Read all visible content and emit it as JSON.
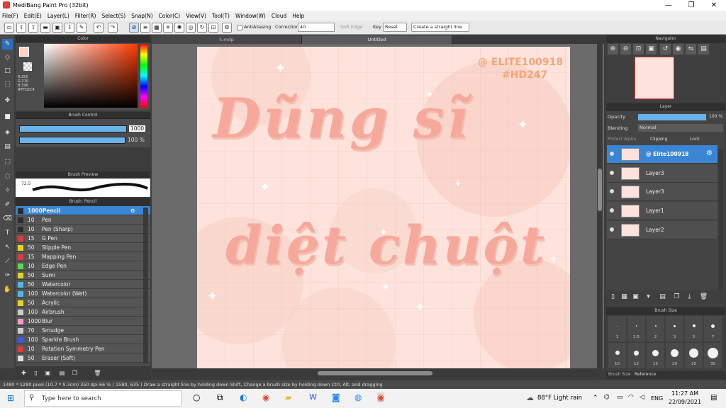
{
  "window": {
    "title": "MediBang Paint Pro (32bit)"
  },
  "menu": [
    "File(F)",
    "Edit(E)",
    "Layer(L)",
    "Filter(R)",
    "Select(S)",
    "Snap(N)",
    "Color(C)",
    "View(V)",
    "Tool(T)",
    "Window(W)",
    "Cloud",
    "Help"
  ],
  "toolbar": {
    "antialias": "AntiAliasing",
    "correction_label": "Correction",
    "correction_value": "40",
    "soft_edge": "Soft Edge",
    "key": "Key",
    "reset": "Reset",
    "straight_line": "Create a straight line"
  },
  "color_panel": {
    "title": "Color",
    "rgb": "R:255\nG:210\nB:196\n#FFD2C4"
  },
  "brush_control": {
    "title": "Brush Control",
    "size": "1000",
    "opacity": "100 %"
  },
  "brush_preview": {
    "title": "Brush Preview",
    "size_label": "72.5"
  },
  "brush_panel": {
    "title": "Brush: Pencil",
    "items": [
      {
        "size": "1000",
        "name": "1000Pencil",
        "color": "#2b2b2b",
        "selected": true
      },
      {
        "size": "10",
        "name": "Pen",
        "color": "#2b2b2b"
      },
      {
        "size": "10",
        "name": "Pen (Sharp)",
        "color": "#2b2b2b"
      },
      {
        "size": "15",
        "name": "G Pen",
        "color": "#e23a3a"
      },
      {
        "size": "50",
        "name": "Slipple Pen",
        "color": "#e6d321"
      },
      {
        "size": "15",
        "name": "Mapping Pen",
        "color": "#e23a3a"
      },
      {
        "size": "10",
        "name": "Edge Pen",
        "color": "#5bd84b"
      },
      {
        "size": "50",
        "name": "Sumi",
        "color": "#e6d321"
      },
      {
        "size": "50",
        "name": "Watercolor",
        "color": "#4db8e6"
      },
      {
        "size": "100",
        "name": "Watercolor (Wet)",
        "color": "#4db8e6"
      },
      {
        "size": "50",
        "name": "Acrylic",
        "color": "#e6d321"
      },
      {
        "size": "100",
        "name": "Airbrush",
        "color": "#cccccc"
      },
      {
        "size": "1000",
        "name": "Blur",
        "color": "#f39ad1"
      },
      {
        "size": "70",
        "name": "Smudge",
        "color": "#cccccc"
      },
      {
        "size": "100",
        "name": "Sparkle Brush",
        "color": "#3a5be2"
      },
      {
        "size": "10",
        "name": "Rotation Symmetry Pen",
        "color": "#e23a3a"
      },
      {
        "size": "50",
        "name": "Eraser (Soft)",
        "color": "#dddddd"
      }
    ]
  },
  "doc_tabs": [
    "5.mdp",
    "Untitled"
  ],
  "canvas": {
    "lettering_line1": "Dũng sĩ",
    "lettering_line2": "diệt chuột",
    "credit_line1": "@ ELITE100918",
    "credit_line2": "#HD247"
  },
  "navigator": {
    "title": "Navigator"
  },
  "layer_panel": {
    "title": "Layer",
    "opacity_label": "Opacity",
    "opacity_value": "100 %",
    "blending_label": "Blending",
    "blending_value": "Normal",
    "protect_alpha": "Protect Alpha",
    "clipping": "Clipping",
    "lock": "Lock",
    "layers": [
      {
        "name": "@ Elite100918",
        "selected": true
      },
      {
        "name": "Layer3"
      },
      {
        "name": "Layer3"
      },
      {
        "name": "Layer1"
      },
      {
        "name": "Layer2"
      }
    ]
  },
  "brush_size_panel": {
    "title": "Brush Size",
    "sizes": [
      "1",
      "1.5",
      "2",
      "3",
      "5",
      "7",
      "10",
      "12",
      "15",
      "20",
      "25",
      "30"
    ],
    "tabs": [
      "Brush Size",
      "Reference"
    ]
  },
  "status": {
    "text": "1480 * 1280 pixel   (10.7 * 9.3cm)   350 dpi   66 %   ( 1580, 635 )   Draw a straight line by holding down Shift, Change a brush size by holding down Ctrl, Alt, and dragging"
  },
  "taskbar": {
    "search": "Type here to search",
    "weather": "88°F  Light rain",
    "lang": "ENG",
    "time": "11:27 AM",
    "date": "22/09/2021"
  }
}
